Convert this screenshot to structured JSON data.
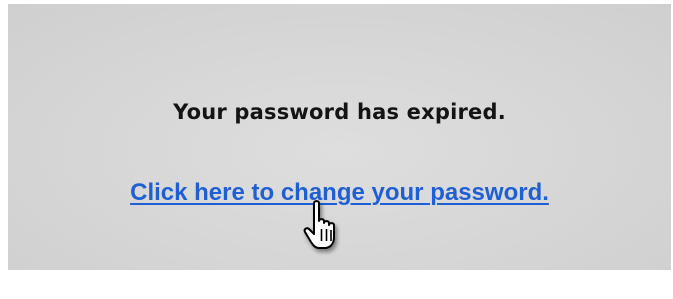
{
  "message": {
    "text": "Your password has expired."
  },
  "link": {
    "text": "Click here to change your password.",
    "color": "#1f5fd6"
  },
  "cursor": {
    "icon": "hand-pointer-icon"
  },
  "colors": {
    "panel_background": "#d8d8d8",
    "text": "#141414"
  }
}
